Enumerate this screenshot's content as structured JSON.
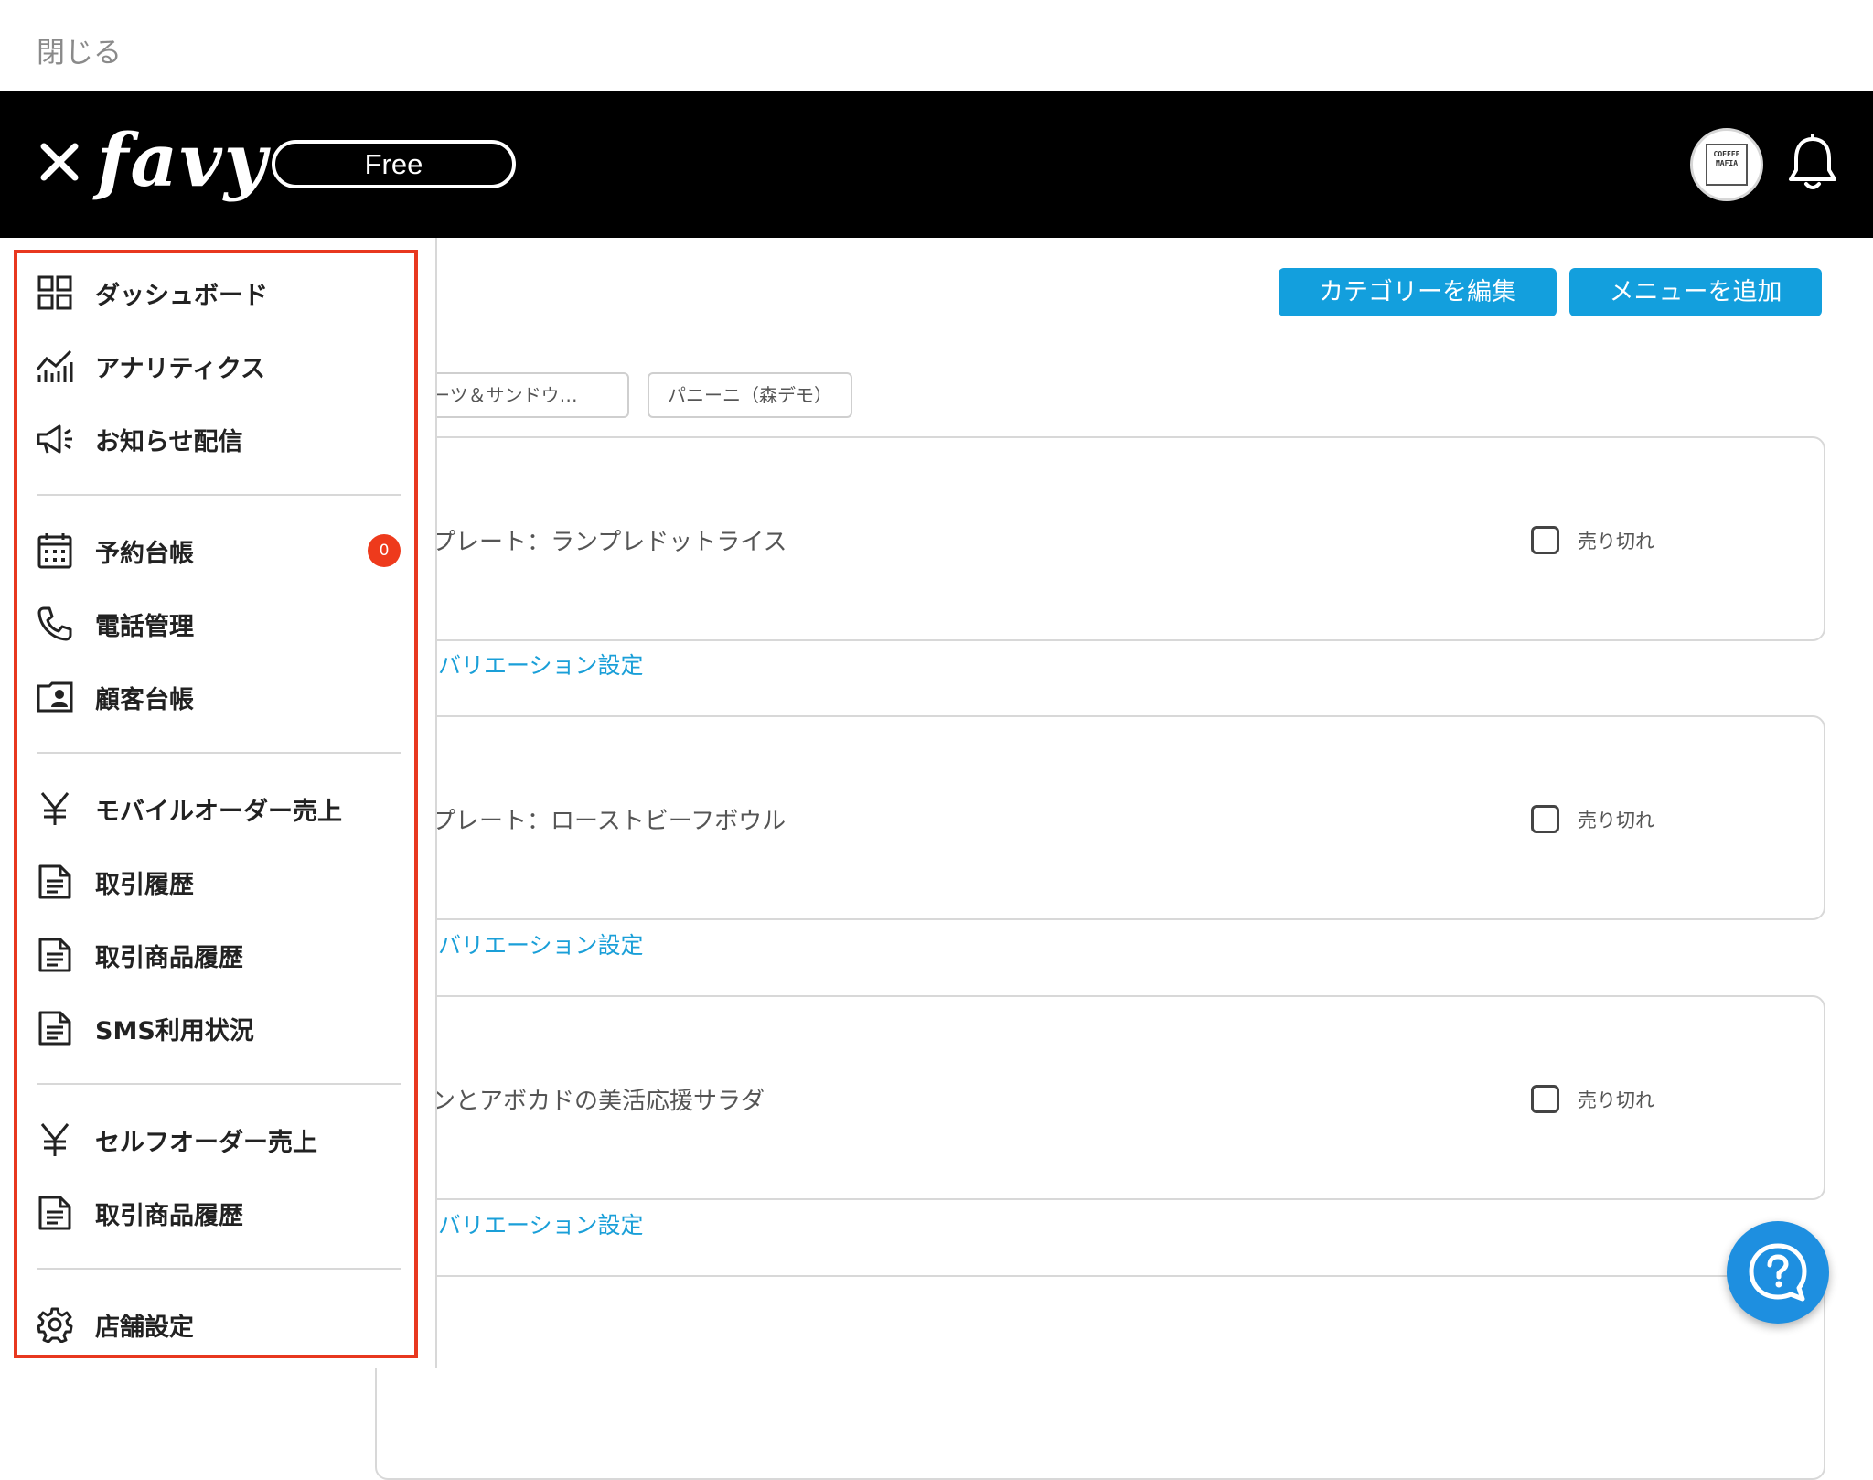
{
  "close_bar": {
    "label": "閉じる"
  },
  "header": {
    "logo": "favy",
    "plan_badge": "Free",
    "avatar_text": "COFFEE MAFIA"
  },
  "toolbar": {
    "edit_category_label": "カテゴリーを編集",
    "add_menu_label": "メニューを追加"
  },
  "category_chips": [
    {
      "label": "スイーツ＆サンドウ…"
    },
    {
      "label": "パニーニ（森デモ）"
    }
  ],
  "menu_cards": [
    {
      "title": "プレート：ランプレドットライス",
      "soldout_label": "売り切れ",
      "soldout_checked": false,
      "variation_link": "-バリエーション設定"
    },
    {
      "title": "プレート：ローストビーフボウル",
      "soldout_label": "売り切れ",
      "soldout_checked": false,
      "variation_link": "-バリエーション設定"
    },
    {
      "title": "ンとアボカドの美活応援サラダ",
      "soldout_label": "売り切れ",
      "soldout_checked": false,
      "variation_link": "-バリエーション設定"
    }
  ],
  "sidebar": {
    "highlight_color": "#e8381f",
    "items": [
      {
        "icon": "grid-icon",
        "label": "ダッシュボード"
      },
      {
        "icon": "analytics-icon",
        "label": "アナリティクス"
      },
      {
        "icon": "megaphone-icon",
        "label": "お知らせ配信"
      },
      {
        "icon": "calendar-icon",
        "label": "予約台帳",
        "badge": "0"
      },
      {
        "icon": "phone-icon",
        "label": "電話管理"
      },
      {
        "icon": "contact-card-icon",
        "label": "顧客台帳"
      },
      {
        "icon": "yen-icon",
        "label": "モバイルオーダー売上"
      },
      {
        "icon": "document-icon",
        "label": "取引履歴"
      },
      {
        "icon": "document-icon",
        "label": "取引商品履歴"
      },
      {
        "icon": "document-icon",
        "label": "SMS利用状況"
      },
      {
        "icon": "yen-icon",
        "label": "セルフオーダー売上"
      },
      {
        "icon": "document-icon",
        "label": "取引商品履歴"
      },
      {
        "icon": "gear-icon",
        "label": "店舗設定"
      }
    ]
  },
  "colors": {
    "header_bg": "#000000",
    "accent_button": "#139fdd",
    "link": "#1a9fd8",
    "badge": "#ee3a1c",
    "help_button": "#1e8fe0"
  }
}
